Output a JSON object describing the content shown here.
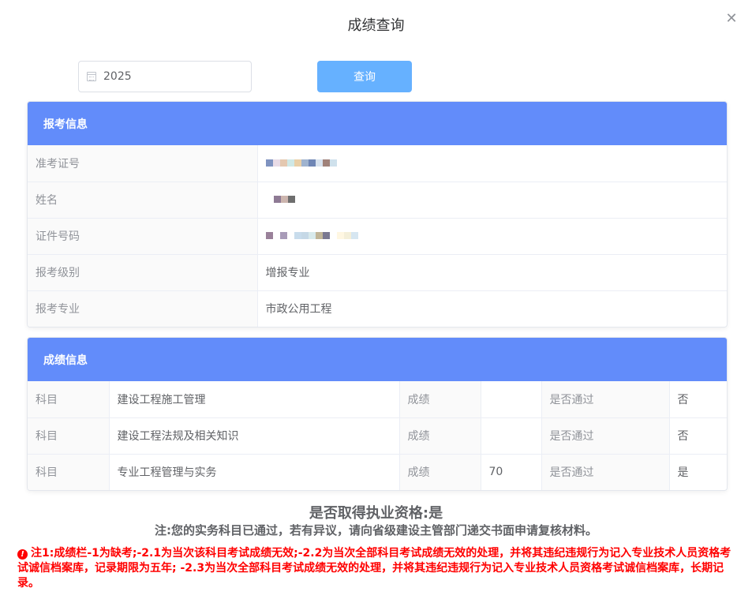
{
  "dialog": {
    "title": "成绩查询",
    "close_icon": "close-icon"
  },
  "search": {
    "year_value": "2025",
    "query_label": "查询"
  },
  "registration": {
    "header": "报考信息",
    "rows": [
      {
        "label": "准考证号",
        "value": "",
        "masked": true
      },
      {
        "label": "姓名",
        "value": "",
        "masked": true
      },
      {
        "label": "证件号码",
        "value": "",
        "masked": true
      },
      {
        "label": "报考级别",
        "value": "增报专业"
      },
      {
        "label": "报考专业",
        "value": "市政公用工程"
      }
    ]
  },
  "scores": {
    "header": "成绩信息",
    "rows": [
      {
        "subject_label": "科目",
        "subject": "建设工程施工管理",
        "score_label": "成绩",
        "score": "",
        "pass_label": "是否通过",
        "pass": "否"
      },
      {
        "subject_label": "科目",
        "subject": "建设工程法规及相关知识",
        "score_label": "成绩",
        "score": "",
        "pass_label": "是否通过",
        "pass": "否"
      },
      {
        "subject_label": "科目",
        "subject": "专业工程管理与实务",
        "score_label": "成绩",
        "score": "70",
        "pass_label": "是否通过",
        "pass": "是"
      }
    ]
  },
  "qualification": "是否取得执业资格:是",
  "note": "注:您的实务科目已通过，若有异议，请向省级建设主管部门递交书面申请复核材料。",
  "warning": {
    "icon": "exclamation-icon",
    "text": "注1:成绩栏-1为缺考;-2.1为当次该科目考试成绩无效;-2.2为当次全部科目考试成绩无效的处理，并将其违纪违规行为记入专业技术人员资格考试诚信档案库，记录期限为五年; -2.3为当次全部科目考试成绩无效的处理，并将其违纪违规行为记入专业技术人员资格考试诚信档案库，长期记录。"
  },
  "colors": {
    "header_blue": "#628cfa",
    "button_blue": "#66b1ff",
    "warning_red": "#ff0000"
  }
}
